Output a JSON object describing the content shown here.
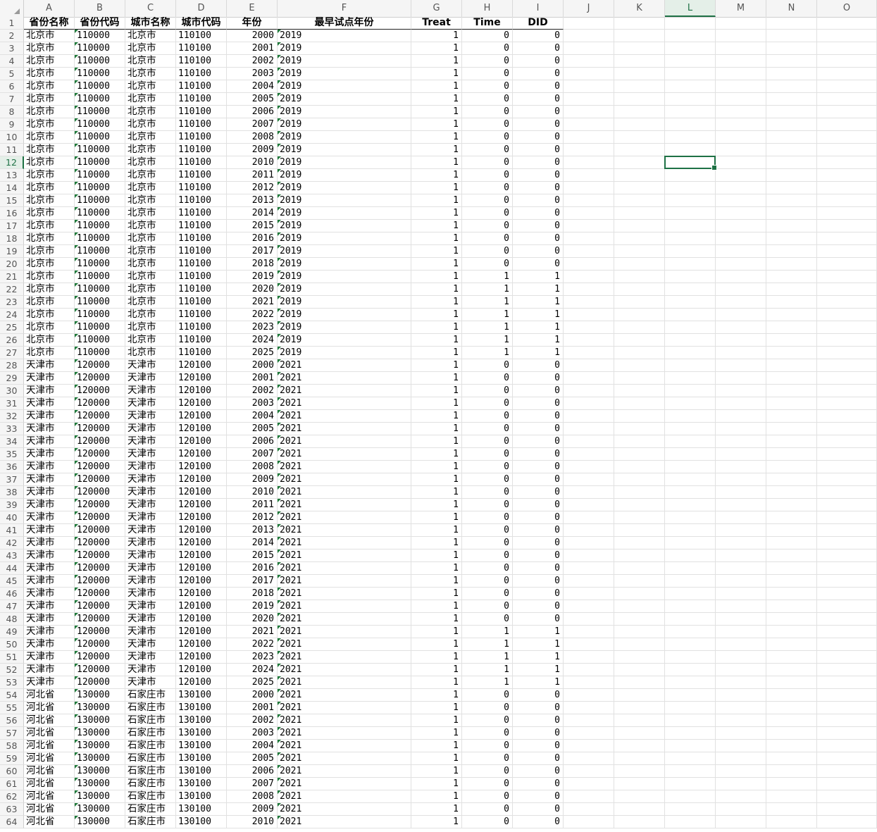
{
  "grid": {
    "columns": [
      "A",
      "B",
      "C",
      "D",
      "E",
      "F",
      "G",
      "H",
      "I",
      "J",
      "K",
      "L",
      "M",
      "N",
      "O"
    ],
    "selected_column": "L",
    "selected_row": 12,
    "header_row": [
      "省份名称",
      "省份代码",
      "城市名称",
      "城市代码",
      "年份",
      "最早试点年份",
      "Treat",
      "Time",
      "DID"
    ]
  },
  "rows": [
    [
      "北京市",
      "110000",
      "北京市",
      "110100",
      "2000",
      "2019",
      "1",
      "0",
      "0"
    ],
    [
      "北京市",
      "110000",
      "北京市",
      "110100",
      "2001",
      "2019",
      "1",
      "0",
      "0"
    ],
    [
      "北京市",
      "110000",
      "北京市",
      "110100",
      "2002",
      "2019",
      "1",
      "0",
      "0"
    ],
    [
      "北京市",
      "110000",
      "北京市",
      "110100",
      "2003",
      "2019",
      "1",
      "0",
      "0"
    ],
    [
      "北京市",
      "110000",
      "北京市",
      "110100",
      "2004",
      "2019",
      "1",
      "0",
      "0"
    ],
    [
      "北京市",
      "110000",
      "北京市",
      "110100",
      "2005",
      "2019",
      "1",
      "0",
      "0"
    ],
    [
      "北京市",
      "110000",
      "北京市",
      "110100",
      "2006",
      "2019",
      "1",
      "0",
      "0"
    ],
    [
      "北京市",
      "110000",
      "北京市",
      "110100",
      "2007",
      "2019",
      "1",
      "0",
      "0"
    ],
    [
      "北京市",
      "110000",
      "北京市",
      "110100",
      "2008",
      "2019",
      "1",
      "0",
      "0"
    ],
    [
      "北京市",
      "110000",
      "北京市",
      "110100",
      "2009",
      "2019",
      "1",
      "0",
      "0"
    ],
    [
      "北京市",
      "110000",
      "北京市",
      "110100",
      "2010",
      "2019",
      "1",
      "0",
      "0"
    ],
    [
      "北京市",
      "110000",
      "北京市",
      "110100",
      "2011",
      "2019",
      "1",
      "0",
      "0"
    ],
    [
      "北京市",
      "110000",
      "北京市",
      "110100",
      "2012",
      "2019",
      "1",
      "0",
      "0"
    ],
    [
      "北京市",
      "110000",
      "北京市",
      "110100",
      "2013",
      "2019",
      "1",
      "0",
      "0"
    ],
    [
      "北京市",
      "110000",
      "北京市",
      "110100",
      "2014",
      "2019",
      "1",
      "0",
      "0"
    ],
    [
      "北京市",
      "110000",
      "北京市",
      "110100",
      "2015",
      "2019",
      "1",
      "0",
      "0"
    ],
    [
      "北京市",
      "110000",
      "北京市",
      "110100",
      "2016",
      "2019",
      "1",
      "0",
      "0"
    ],
    [
      "北京市",
      "110000",
      "北京市",
      "110100",
      "2017",
      "2019",
      "1",
      "0",
      "0"
    ],
    [
      "北京市",
      "110000",
      "北京市",
      "110100",
      "2018",
      "2019",
      "1",
      "0",
      "0"
    ],
    [
      "北京市",
      "110000",
      "北京市",
      "110100",
      "2019",
      "2019",
      "1",
      "1",
      "1"
    ],
    [
      "北京市",
      "110000",
      "北京市",
      "110100",
      "2020",
      "2019",
      "1",
      "1",
      "1"
    ],
    [
      "北京市",
      "110000",
      "北京市",
      "110100",
      "2021",
      "2019",
      "1",
      "1",
      "1"
    ],
    [
      "北京市",
      "110000",
      "北京市",
      "110100",
      "2022",
      "2019",
      "1",
      "1",
      "1"
    ],
    [
      "北京市",
      "110000",
      "北京市",
      "110100",
      "2023",
      "2019",
      "1",
      "1",
      "1"
    ],
    [
      "北京市",
      "110000",
      "北京市",
      "110100",
      "2024",
      "2019",
      "1",
      "1",
      "1"
    ],
    [
      "北京市",
      "110000",
      "北京市",
      "110100",
      "2025",
      "2019",
      "1",
      "1",
      "1"
    ],
    [
      "天津市",
      "120000",
      "天津市",
      "120100",
      "2000",
      "2021",
      "1",
      "0",
      "0"
    ],
    [
      "天津市",
      "120000",
      "天津市",
      "120100",
      "2001",
      "2021",
      "1",
      "0",
      "0"
    ],
    [
      "天津市",
      "120000",
      "天津市",
      "120100",
      "2002",
      "2021",
      "1",
      "0",
      "0"
    ],
    [
      "天津市",
      "120000",
      "天津市",
      "120100",
      "2003",
      "2021",
      "1",
      "0",
      "0"
    ],
    [
      "天津市",
      "120000",
      "天津市",
      "120100",
      "2004",
      "2021",
      "1",
      "0",
      "0"
    ],
    [
      "天津市",
      "120000",
      "天津市",
      "120100",
      "2005",
      "2021",
      "1",
      "0",
      "0"
    ],
    [
      "天津市",
      "120000",
      "天津市",
      "120100",
      "2006",
      "2021",
      "1",
      "0",
      "0"
    ],
    [
      "天津市",
      "120000",
      "天津市",
      "120100",
      "2007",
      "2021",
      "1",
      "0",
      "0"
    ],
    [
      "天津市",
      "120000",
      "天津市",
      "120100",
      "2008",
      "2021",
      "1",
      "0",
      "0"
    ],
    [
      "天津市",
      "120000",
      "天津市",
      "120100",
      "2009",
      "2021",
      "1",
      "0",
      "0"
    ],
    [
      "天津市",
      "120000",
      "天津市",
      "120100",
      "2010",
      "2021",
      "1",
      "0",
      "0"
    ],
    [
      "天津市",
      "120000",
      "天津市",
      "120100",
      "2011",
      "2021",
      "1",
      "0",
      "0"
    ],
    [
      "天津市",
      "120000",
      "天津市",
      "120100",
      "2012",
      "2021",
      "1",
      "0",
      "0"
    ],
    [
      "天津市",
      "120000",
      "天津市",
      "120100",
      "2013",
      "2021",
      "1",
      "0",
      "0"
    ],
    [
      "天津市",
      "120000",
      "天津市",
      "120100",
      "2014",
      "2021",
      "1",
      "0",
      "0"
    ],
    [
      "天津市",
      "120000",
      "天津市",
      "120100",
      "2015",
      "2021",
      "1",
      "0",
      "0"
    ],
    [
      "天津市",
      "120000",
      "天津市",
      "120100",
      "2016",
      "2021",
      "1",
      "0",
      "0"
    ],
    [
      "天津市",
      "120000",
      "天津市",
      "120100",
      "2017",
      "2021",
      "1",
      "0",
      "0"
    ],
    [
      "天津市",
      "120000",
      "天津市",
      "120100",
      "2018",
      "2021",
      "1",
      "0",
      "0"
    ],
    [
      "天津市",
      "120000",
      "天津市",
      "120100",
      "2019",
      "2021",
      "1",
      "0",
      "0"
    ],
    [
      "天津市",
      "120000",
      "天津市",
      "120100",
      "2020",
      "2021",
      "1",
      "0",
      "0"
    ],
    [
      "天津市",
      "120000",
      "天津市",
      "120100",
      "2021",
      "2021",
      "1",
      "1",
      "1"
    ],
    [
      "天津市",
      "120000",
      "天津市",
      "120100",
      "2022",
      "2021",
      "1",
      "1",
      "1"
    ],
    [
      "天津市",
      "120000",
      "天津市",
      "120100",
      "2023",
      "2021",
      "1",
      "1",
      "1"
    ],
    [
      "天津市",
      "120000",
      "天津市",
      "120100",
      "2024",
      "2021",
      "1",
      "1",
      "1"
    ],
    [
      "天津市",
      "120000",
      "天津市",
      "120100",
      "2025",
      "2021",
      "1",
      "1",
      "1"
    ],
    [
      "河北省",
      "130000",
      "石家庄市",
      "130100",
      "2000",
      "2021",
      "1",
      "0",
      "0"
    ],
    [
      "河北省",
      "130000",
      "石家庄市",
      "130100",
      "2001",
      "2021",
      "1",
      "0",
      "0"
    ],
    [
      "河北省",
      "130000",
      "石家庄市",
      "130100",
      "2002",
      "2021",
      "1",
      "0",
      "0"
    ],
    [
      "河北省",
      "130000",
      "石家庄市",
      "130100",
      "2003",
      "2021",
      "1",
      "0",
      "0"
    ],
    [
      "河北省",
      "130000",
      "石家庄市",
      "130100",
      "2004",
      "2021",
      "1",
      "0",
      "0"
    ],
    [
      "河北省",
      "130000",
      "石家庄市",
      "130100",
      "2005",
      "2021",
      "1",
      "0",
      "0"
    ],
    [
      "河北省",
      "130000",
      "石家庄市",
      "130100",
      "2006",
      "2021",
      "1",
      "0",
      "0"
    ],
    [
      "河北省",
      "130000",
      "石家庄市",
      "130100",
      "2007",
      "2021",
      "1",
      "0",
      "0"
    ],
    [
      "河北省",
      "130000",
      "石家庄市",
      "130100",
      "2008",
      "2021",
      "1",
      "0",
      "0"
    ],
    [
      "河北省",
      "130000",
      "石家庄市",
      "130100",
      "2009",
      "2021",
      "1",
      "0",
      "0"
    ],
    [
      "河北省",
      "130000",
      "石家庄市",
      "130100",
      "2010",
      "2021",
      "1",
      "0",
      "0"
    ]
  ]
}
